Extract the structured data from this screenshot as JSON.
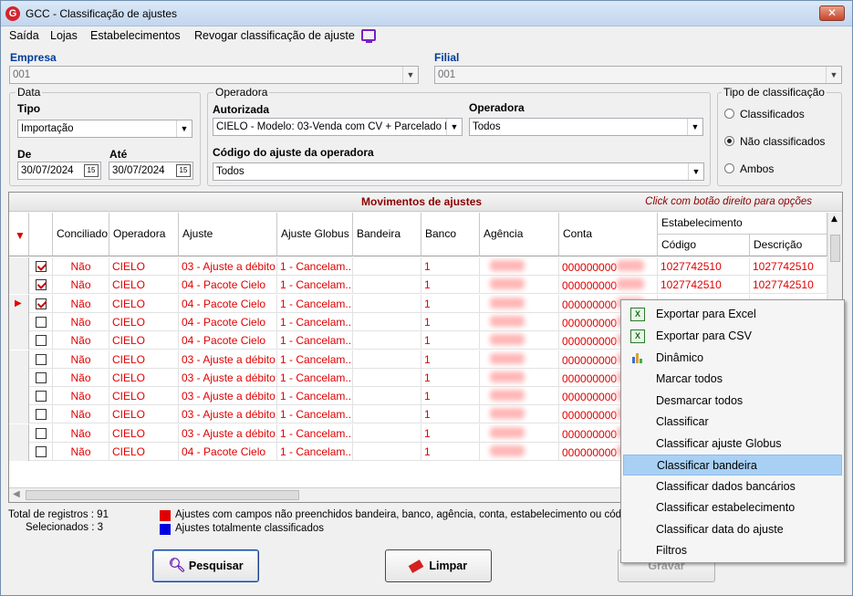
{
  "window": {
    "title": "GCC - Classificação de ajustes",
    "app_icon": "G",
    "close_label": "✕"
  },
  "menu": {
    "items": [
      "Saída",
      "Lojas",
      "Estabelecimentos",
      "Revogar classificação de ajuste"
    ]
  },
  "empresa": {
    "label": "Empresa",
    "value": "001"
  },
  "filial": {
    "label": "Filial",
    "value": "001"
  },
  "data_group": {
    "title": "Data",
    "tipo_label": "Tipo",
    "tipo_value": "Importação",
    "de_label": "De",
    "de_value": "30/07/2024",
    "ate_label": "Até",
    "ate_value": "30/07/2024",
    "cal_glyph": "15"
  },
  "operadora_group": {
    "title": "Operadora",
    "autorizada_label": "Autorizada",
    "autorizada_value": "CIELO - Modelo: 03-Venda com CV + Parcelado F",
    "operadora_label": "Operadora",
    "operadora_value": "Todos",
    "codigo_label": "Código do ajuste da operadora",
    "codigo_value": "Todos"
  },
  "tipo_class": {
    "title": "Tipo de classificação",
    "options": [
      "Classificados",
      "Não classificados",
      "Ambos"
    ],
    "selected": "Não classificados"
  },
  "grid": {
    "title": "Movimentos de ajustes",
    "hint": "Click com botão direito para opções",
    "headers": {
      "conciliado": "Conciliado",
      "operadora": "Operadora",
      "ajuste": "Ajuste",
      "ajuste_globus": "Ajuste Globus",
      "bandeira": "Bandeira",
      "banco": "Banco",
      "agencia": "Agência",
      "conta": "Conta",
      "estabelecimento": "Estabelecimento",
      "codigo": "Código",
      "descricao": "Descrição"
    },
    "rows": [
      {
        "checked": true,
        "conciliado": "Não",
        "operadora": "CIELO",
        "ajuste": "03 - Ajuste a débito",
        "globus": "1 - Cancelam...",
        "banco": "1",
        "conta": "000000000",
        "codigo": "1027742510",
        "descricao": "1027742510"
      },
      {
        "checked": true,
        "conciliado": "Não",
        "operadora": "CIELO",
        "ajuste": "04 - Pacote Cielo",
        "globus": "1 - Cancelam...",
        "banco": "1",
        "conta": "000000000",
        "codigo": "1027742510",
        "descricao": "1027742510"
      },
      {
        "checked": true,
        "current": true,
        "conciliado": "Não",
        "operadora": "CIELO",
        "ajuste": "04 - Pacote Cielo",
        "globus": "1 - Cancelam...",
        "banco": "1",
        "conta": "000000000",
        "codigo": "1027742510",
        "descricao": "1027742510"
      },
      {
        "checked": false,
        "conciliado": "Não",
        "operadora": "CIELO",
        "ajuste": "04 - Pacote Cielo",
        "globus": "1 - Cancelam...",
        "banco": "1",
        "conta": "000000000",
        "codigo": "",
        "descricao": ""
      },
      {
        "checked": false,
        "conciliado": "Não",
        "operadora": "CIELO",
        "ajuste": "04 - Pacote Cielo",
        "globus": "1 - Cancelam...",
        "banco": "1",
        "conta": "000000000",
        "codigo": "",
        "descricao": ""
      },
      {
        "checked": false,
        "conciliado": "Não",
        "operadora": "CIELO",
        "ajuste": "03 - Ajuste a débito",
        "globus": "1 - Cancelam...",
        "banco": "1",
        "conta": "000000000",
        "codigo": "",
        "descricao": ""
      },
      {
        "checked": false,
        "conciliado": "Não",
        "operadora": "CIELO",
        "ajuste": "03 - Ajuste a débito",
        "globus": "1 - Cancelam...",
        "banco": "1",
        "conta": "000000000",
        "codigo": "",
        "descricao": ""
      },
      {
        "checked": false,
        "conciliado": "Não",
        "operadora": "CIELO",
        "ajuste": "03 - Ajuste a débito",
        "globus": "1 - Cancelam...",
        "banco": "1",
        "conta": "000000000",
        "codigo": "",
        "descricao": ""
      },
      {
        "checked": false,
        "conciliado": "Não",
        "operadora": "CIELO",
        "ajuste": "03 - Ajuste a débito",
        "globus": "1 - Cancelam...",
        "banco": "1",
        "conta": "000000000",
        "codigo": "",
        "descricao": ""
      },
      {
        "checked": false,
        "conciliado": "Não",
        "operadora": "CIELO",
        "ajuste": "03 - Ajuste a débito",
        "globus": "1 - Cancelam...",
        "banco": "1",
        "conta": "000000000",
        "codigo": "",
        "descricao": ""
      },
      {
        "checked": false,
        "conciliado": "Não",
        "operadora": "CIELO",
        "ajuste": "04 - Pacote Cielo",
        "globus": "1 - Cancelam...",
        "banco": "1",
        "conta": "000000000",
        "codigo": "",
        "descricao": ""
      }
    ]
  },
  "status": {
    "total_label": "Total de registros :",
    "total_value": "91",
    "sel_label": "Selecionados :",
    "sel_value": "3"
  },
  "legend": {
    "red_text": "Ajustes com campos não preenchidos bandeira, banco, agência, conta, estabelecimento ou códi",
    "blue_text": "Ajustes totalmente classificados",
    "red_color": "#e00000",
    "blue_color": "#0000e0"
  },
  "buttons": {
    "pesquisar": "Pesquisar",
    "limpar": "Limpar",
    "gravar": "Gravar"
  },
  "context_menu": {
    "items": [
      "Exportar para Excel",
      "Exportar para CSV",
      "Dinâmico",
      "Marcar todos",
      "Desmarcar todos",
      "Classificar",
      "Classificar ajuste Globus",
      "Classificar bandeira",
      "Classificar dados bancários",
      "Classificar estabelecimento",
      "Classificar data do ajuste",
      "Filtros"
    ],
    "highlighted": "Classificar bandeira"
  }
}
